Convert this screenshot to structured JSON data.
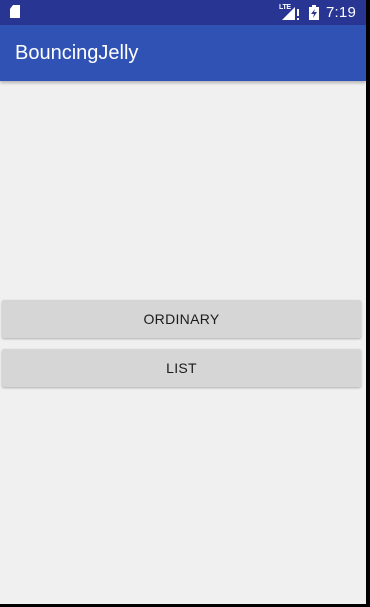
{
  "status_bar": {
    "network_label": "LTE",
    "time": "7:19",
    "icons": [
      "sd-card-icon",
      "lte-signal-icon",
      "battery-charging-icon"
    ]
  },
  "app_bar": {
    "title": "BouncingJelly"
  },
  "buttons": {
    "ordinary": "ORDINARY",
    "list": "LIST"
  },
  "colors": {
    "status_bar": "#283593",
    "app_bar": "#3052b5",
    "background": "#f0f0f0",
    "button": "#d6d6d6"
  }
}
